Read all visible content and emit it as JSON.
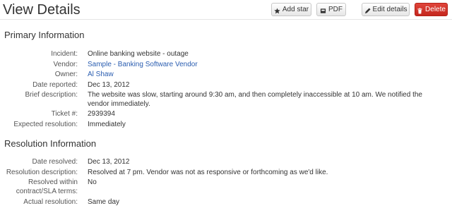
{
  "header": {
    "title": "View Details",
    "buttons": {
      "add_star": "Add star",
      "pdf": "PDF",
      "edit_details": "Edit details",
      "delete": "Delete"
    }
  },
  "primary": {
    "title": "Primary Information",
    "fields": [
      {
        "label": "Incident:",
        "value": "Online banking website - outage"
      },
      {
        "label": "Vendor:",
        "value": "Sample - Banking Software Vendor"
      },
      {
        "label": "Owner:",
        "value": "Al Shaw"
      },
      {
        "label": "Date reported:",
        "value": "Dec 13, 2012"
      },
      {
        "label": "Brief description:",
        "value": "The website was slow, starting around 9:30 am, and then completely inaccessible at 10 am. We notified the vendor immediately."
      },
      {
        "label": "Ticket #:",
        "value": "2939394"
      },
      {
        "label": "Expected resolution:",
        "value": "Immediately"
      }
    ]
  },
  "resolution": {
    "title": "Resolution Information",
    "fields": [
      {
        "label": "Date resolved:",
        "value": "Dec 13, 2012"
      },
      {
        "label": "Resolution description:",
        "value": "Resolved at 7 pm. Vendor was not as responsive or forthcoming as we'd like."
      },
      {
        "label": "Resolved within contract/SLA terms:",
        "value": "No"
      },
      {
        "label": "Actual resolution:",
        "value": "Same day"
      }
    ]
  },
  "colors": {
    "link": "#2a5db0",
    "delete_button": "#d2362c"
  }
}
